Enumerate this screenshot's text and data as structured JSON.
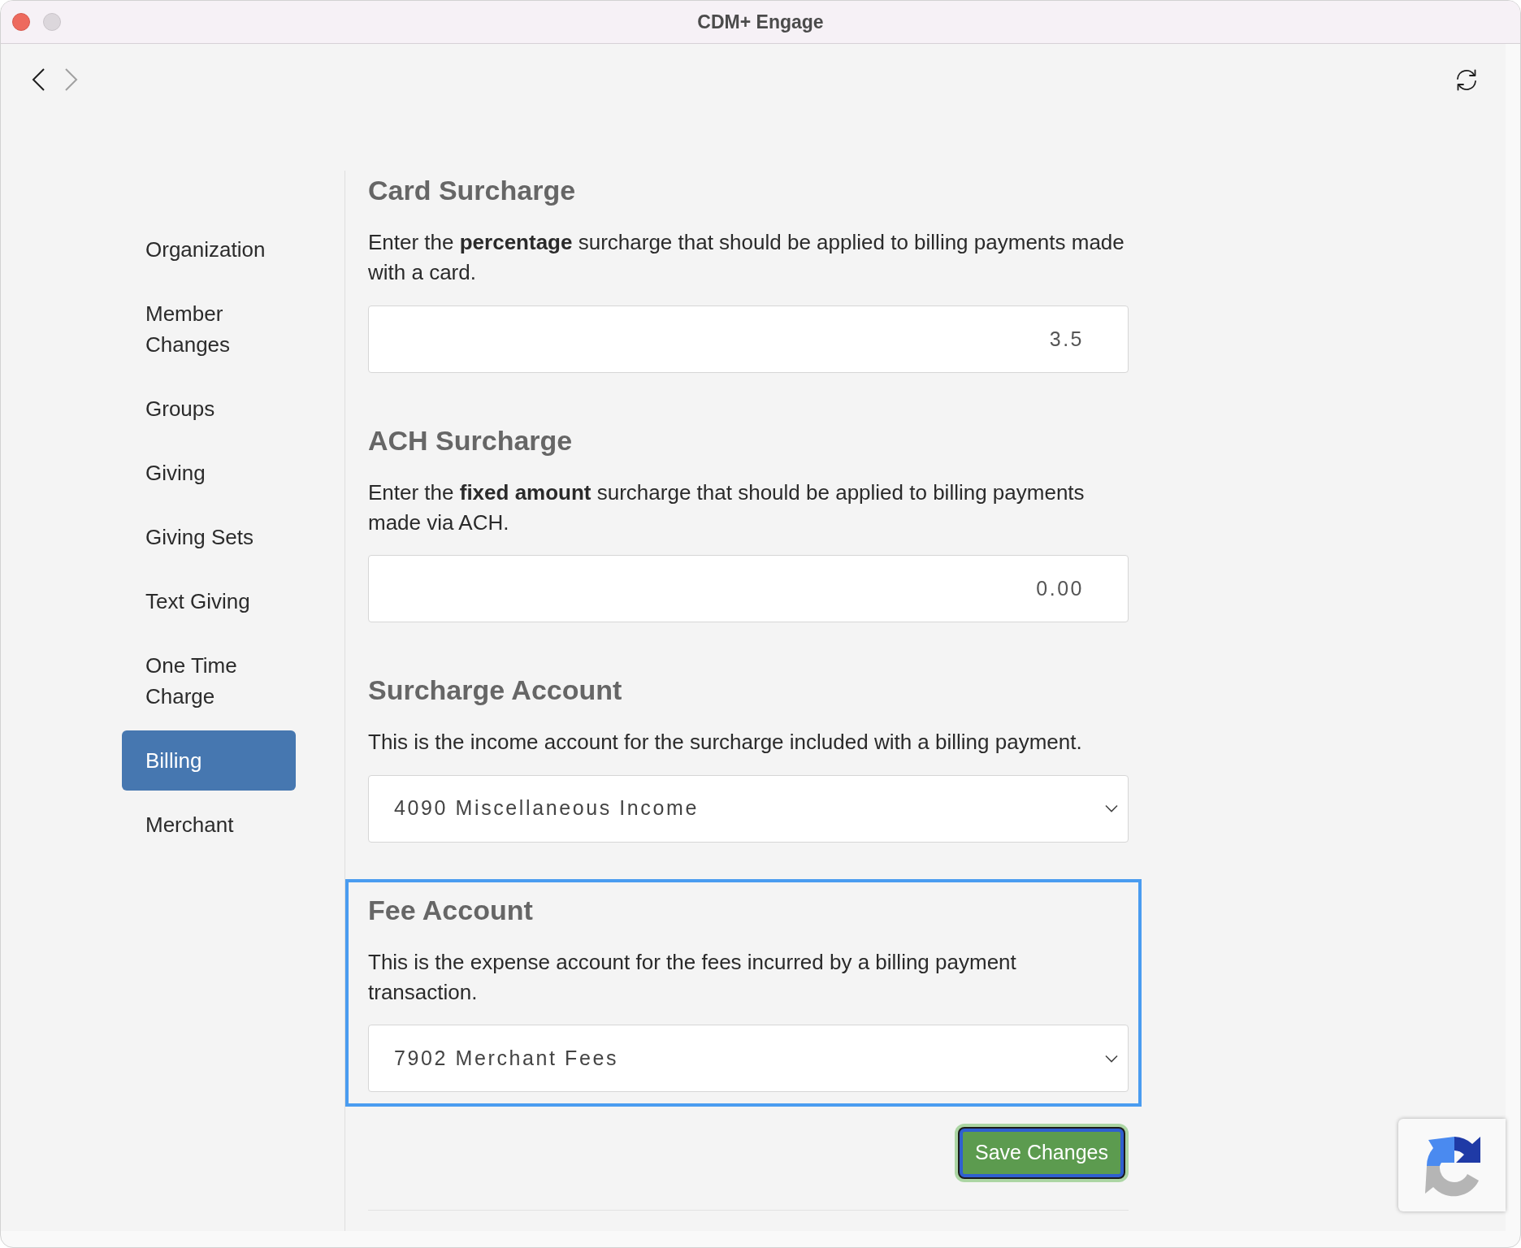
{
  "window": {
    "title": "CDM+ Engage"
  },
  "toolbar": {
    "back": {
      "disabled": false
    },
    "forward": {
      "disabled": true
    }
  },
  "sidebar": {
    "items": [
      {
        "label": "Organization",
        "selected": false
      },
      {
        "label": "Member Changes",
        "selected": false
      },
      {
        "label": "Groups",
        "selected": false
      },
      {
        "label": "Giving",
        "selected": false
      },
      {
        "label": "Giving Sets",
        "selected": false
      },
      {
        "label": "Text Giving",
        "selected": false
      },
      {
        "label": "One Time Charge",
        "selected": false
      },
      {
        "label": "Billing",
        "selected": true
      },
      {
        "label": "Merchant",
        "selected": false
      }
    ]
  },
  "sections": [
    {
      "kind": "input",
      "title": "Card Surcharge",
      "description": "Enter the **percentage** surcharge that should be applied to billing payments made with a card.",
      "value": "3.5",
      "focused": false
    },
    {
      "kind": "input",
      "title": "ACH Surcharge",
      "description": "Enter the **fixed amount** surcharge that should be applied to billing payments made via ACH.",
      "value": "0.00",
      "focused": false
    },
    {
      "kind": "select",
      "title": "Surcharge Account",
      "description": "This is the income account for the surcharge included with a billing payment.",
      "value": "4090 Miscellaneous Income",
      "focused": false
    },
    {
      "kind": "select",
      "title": "Fee Account",
      "description": "This is the expense account for the fees incurred by a billing payment transaction.",
      "value": "7902 Merchant Fees",
      "focused": true
    }
  ],
  "save_button": {
    "label": "Save Changes",
    "focused": true
  }
}
